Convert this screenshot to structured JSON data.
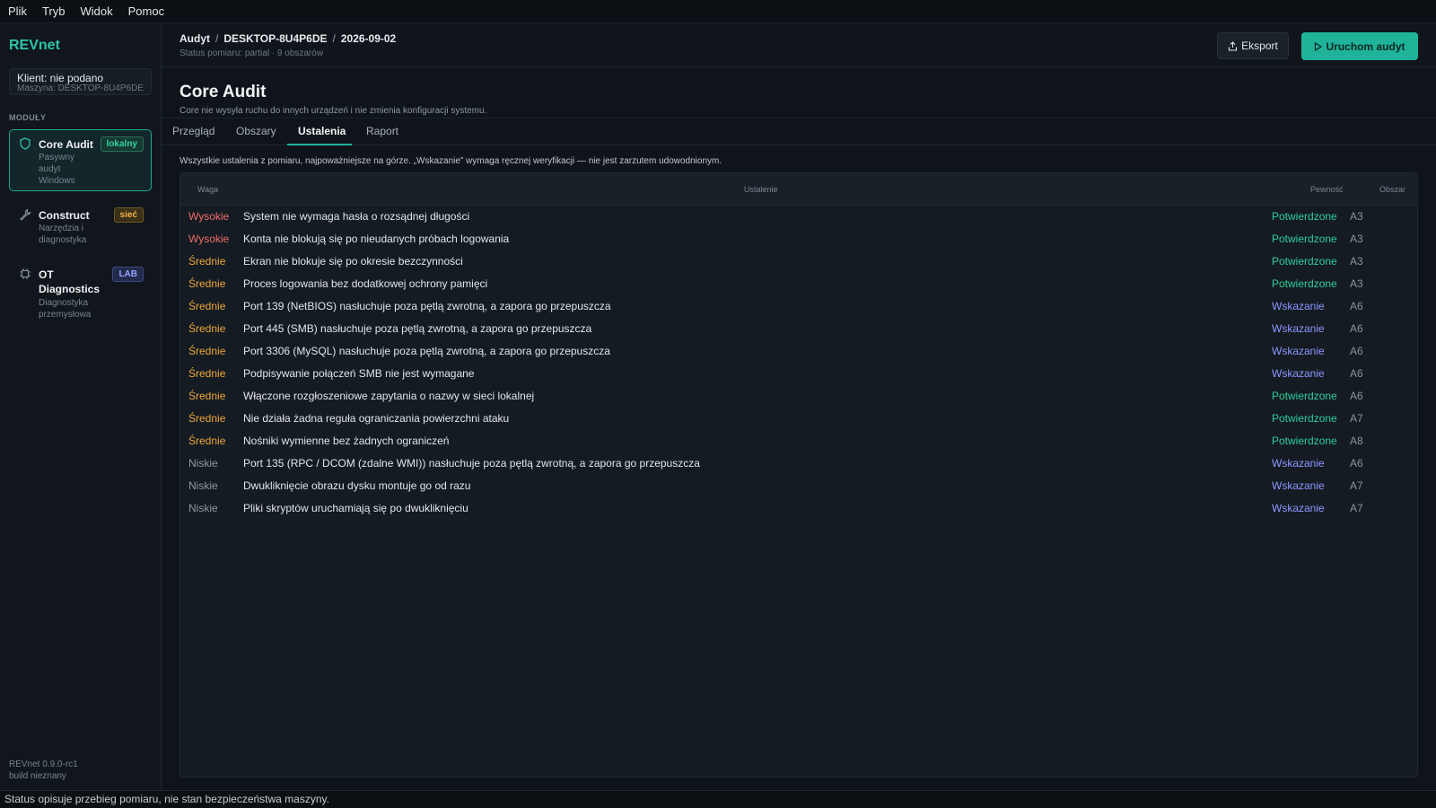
{
  "menu": [
    "Plik",
    "Tryb",
    "Widok",
    "Pomoc"
  ],
  "sidebar": {
    "brand": "REVnet",
    "client": "Klient: nie podano",
    "machine": "Maszyna: DESKTOP-8U4P6DE",
    "section": "MODUŁY",
    "modules": [
      {
        "title": "Core Audit",
        "sub": [
          "Pasywny",
          "audyt",
          "Windows"
        ],
        "badge": "lokalny",
        "icon": "shield-icon"
      },
      {
        "title": "Construct",
        "sub": [
          "Narzędzia i",
          "diagnostyka"
        ],
        "badge": "sieć",
        "icon": "wrench-icon"
      },
      {
        "title_lines": [
          "OT",
          "Diagnostics"
        ],
        "sub": [
          "Diagnostyka",
          "przemysłowa"
        ],
        "badge": "LAB",
        "icon": "chip-icon"
      }
    ],
    "version": "REVnet 0.9.0-rc1",
    "build": "build nieznany"
  },
  "header": {
    "crumbs": [
      "Audyt",
      "DESKTOP-8U4P6DE",
      "2026-09-02"
    ],
    "crumb_sep": "/",
    "status": "Status pomiaru: partial · 9 obszarów",
    "export_label": "Eksport",
    "run_label": "Uruchom audyt"
  },
  "main": {
    "title": "Core Audit",
    "desc": "Core nie wysyła ruchu do innych urządzeń i nie zmienia konfiguracji systemu.",
    "tabs": [
      "Przegląd",
      "Obszary",
      "Ustalenia",
      "Raport"
    ],
    "active_tab": 2,
    "intro": "Wszystkie ustalenia z pomiaru, najpoważniejsze na górze. „Wskazanie” wymaga ręcznej weryfikacji — nie jest zarzutem udowodnionym."
  },
  "table": {
    "headers": {
      "weight": "Waga",
      "finding": "Ustalenie",
      "certainty": "Pewność",
      "area": "Obszar"
    },
    "rows": [
      {
        "weight": "Wysokie",
        "level": "high",
        "finding": "System nie wymaga hasła o rozsądnej długości",
        "certainty": "Potwierdzone",
        "ctype": "conf",
        "area": "A3"
      },
      {
        "weight": "Wysokie",
        "level": "high",
        "finding": "Konta nie blokują się po nieudanych próbach logowania",
        "certainty": "Potwierdzone",
        "ctype": "conf",
        "area": "A3"
      },
      {
        "weight": "Średnie",
        "level": "mid",
        "finding": "Ekran nie blokuje się po okresie bezczynności",
        "certainty": "Potwierdzone",
        "ctype": "conf",
        "area": "A3"
      },
      {
        "weight": "Średnie",
        "level": "mid",
        "finding": "Proces logowania bez dodatkowej ochrony pamięci",
        "certainty": "Potwierdzone",
        "ctype": "conf",
        "area": "A3"
      },
      {
        "weight": "Średnie",
        "level": "mid",
        "finding": "Port 139 (NetBIOS) nasłuchuje poza pętlą zwrotną, a zapora go przepuszcza",
        "certainty": "Wskazanie",
        "ctype": "ind",
        "area": "A6"
      },
      {
        "weight": "Średnie",
        "level": "mid",
        "finding": "Port 445 (SMB) nasłuchuje poza pętlą zwrotną, a zapora go przepuszcza",
        "certainty": "Wskazanie",
        "ctype": "ind",
        "area": "A6"
      },
      {
        "weight": "Średnie",
        "level": "mid",
        "finding": "Port 3306 (MySQL) nasłuchuje poza pętlą zwrotną, a zapora go przepuszcza",
        "certainty": "Wskazanie",
        "ctype": "ind",
        "area": "A6"
      },
      {
        "weight": "Średnie",
        "level": "mid",
        "finding": "Podpisywanie połączeń SMB nie jest wymagane",
        "certainty": "Wskazanie",
        "ctype": "ind",
        "area": "A6"
      },
      {
        "weight": "Średnie",
        "level": "mid",
        "finding": "Włączone rozgłoszeniowe zapytania o nazwy w sieci lokalnej",
        "certainty": "Potwierdzone",
        "ctype": "conf",
        "area": "A6"
      },
      {
        "weight": "Średnie",
        "level": "mid",
        "finding": "Nie działa żadna reguła ograniczania powierzchni ataku",
        "certainty": "Potwierdzone",
        "ctype": "conf",
        "area": "A7"
      },
      {
        "weight": "Średnie",
        "level": "mid",
        "finding": "Nośniki wymienne bez żadnych ograniczeń",
        "certainty": "Potwierdzone",
        "ctype": "conf",
        "area": "A8"
      },
      {
        "weight": "Niskie",
        "level": "low",
        "finding": "Port 135 (RPC / DCOM (zdalne WMI)) nasłuchuje poza pętlą zwrotną, a zapora go przepuszcza",
        "certainty": "Wskazanie",
        "ctype": "ind",
        "area": "A6"
      },
      {
        "weight": "Niskie",
        "level": "low",
        "finding": "Dwukliknięcie obrazu dysku montuje go od razu",
        "certainty": "Wskazanie",
        "ctype": "ind",
        "area": "A7"
      },
      {
        "weight": "Niskie",
        "level": "low",
        "finding": "Pliki skryptów uruchamiają się po dwukliknięciu",
        "certainty": "Wskazanie",
        "ctype": "ind",
        "area": "A7"
      }
    ]
  },
  "statusbar": "Status opisuje przebieg pomiaru, nie stan bezpieczeństwa maszyny.",
  "colors": {
    "accent": "#1fb39a",
    "high": "#f06b6b",
    "mid": "#f0a73a",
    "confirmed": "#2fcf9a",
    "indication": "#8e96ff"
  }
}
